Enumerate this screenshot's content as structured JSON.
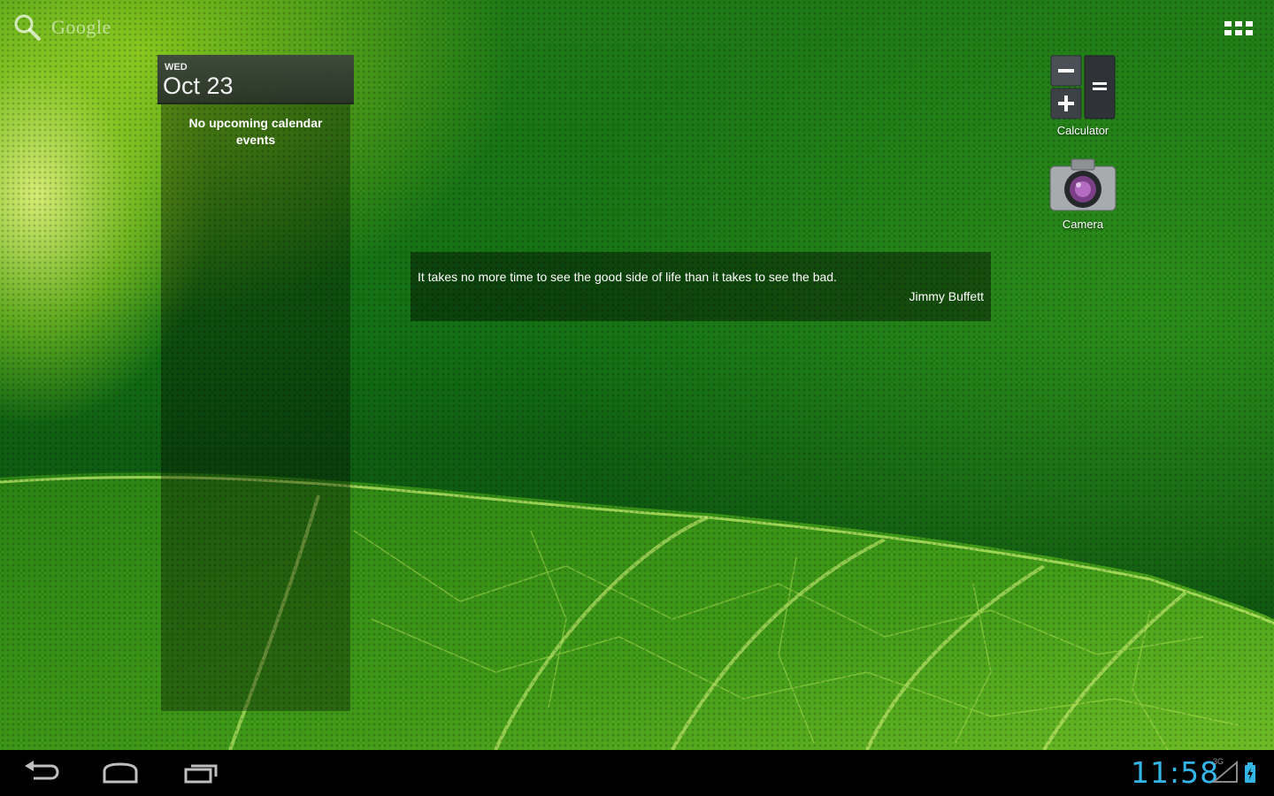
{
  "search": {
    "label": "Google",
    "icon": "search-icon"
  },
  "apps_button": {
    "icon": "all-apps-icon"
  },
  "calendar_widget": {
    "day_of_week": "WED",
    "date": "Oct 23",
    "empty_message": "No upcoming calendar events"
  },
  "quote_widget": {
    "text": "It takes no more time to see the good side of life than it takes to see the bad.",
    "author": "Jimmy Buffett"
  },
  "shortcuts": [
    {
      "label": "Calculator",
      "icon": "calculator-icon"
    },
    {
      "label": "Camera",
      "icon": "camera-icon"
    }
  ],
  "status_bar": {
    "time": "11:58",
    "network_type": "3G",
    "icons": [
      "back-icon",
      "home-icon",
      "recent-apps-icon",
      "signal-icon",
      "battery-icon"
    ],
    "clock_color": "#33b5e5"
  }
}
